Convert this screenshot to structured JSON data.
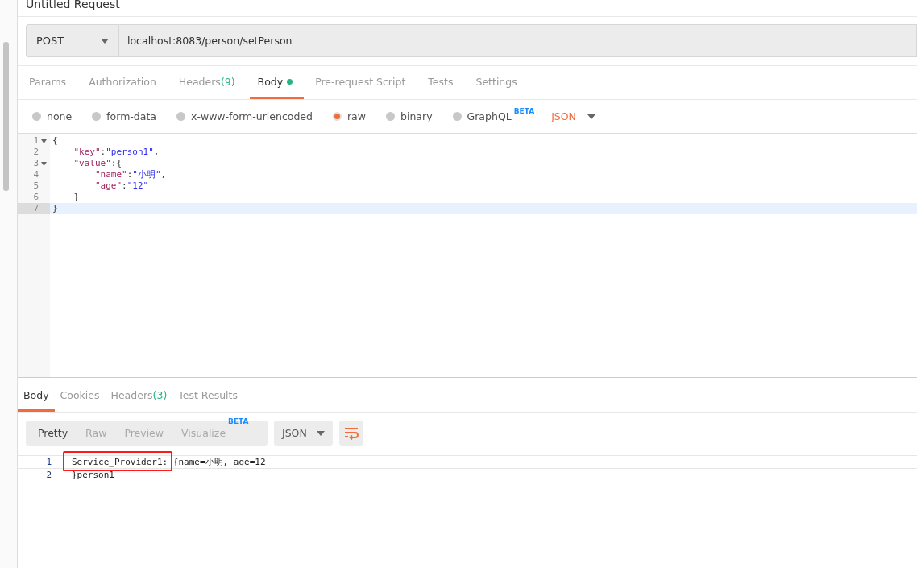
{
  "title": "Untitled Request",
  "request": {
    "method": "POST",
    "url": "localhost:8083/person/setPerson"
  },
  "tabs": [
    {
      "label": "Params",
      "selected": false
    },
    {
      "label": "Authorization",
      "selected": false
    },
    {
      "label": "Headers",
      "count": "(9)",
      "selected": false
    },
    {
      "label": "Body",
      "dot": true,
      "selected": true
    },
    {
      "label": "Pre-request Script",
      "selected": false
    },
    {
      "label": "Tests",
      "selected": false
    },
    {
      "label": "Settings",
      "selected": false
    }
  ],
  "body_types": [
    {
      "label": "none",
      "selected": false
    },
    {
      "label": "form-data",
      "selected": false
    },
    {
      "label": "x-www-form-urlencoded",
      "selected": false
    },
    {
      "label": "raw",
      "selected": true
    },
    {
      "label": "binary",
      "selected": false
    },
    {
      "label": "GraphQL",
      "badge": "BETA",
      "selected": false
    }
  ],
  "format": "JSON",
  "editor_lines": [
    {
      "number": "1",
      "foldable": true,
      "active": false,
      "tokens": [
        {
          "kind": "punct",
          "text": "{"
        }
      ]
    },
    {
      "number": "2",
      "foldable": false,
      "active": false,
      "tokens": [
        {
          "kind": "key",
          "text": "    \"key\""
        },
        {
          "kind": "punct",
          "text": ":"
        },
        {
          "kind": "str",
          "text": "\"person1\""
        },
        {
          "kind": "punct",
          "text": ","
        }
      ]
    },
    {
      "number": "3",
      "foldable": true,
      "active": false,
      "tokens": [
        {
          "kind": "key",
          "text": "    \"value\""
        },
        {
          "kind": "punct",
          "text": ":{"
        }
      ]
    },
    {
      "number": "4",
      "foldable": false,
      "active": false,
      "tokens": [
        {
          "kind": "key",
          "text": "        \"name\""
        },
        {
          "kind": "punct",
          "text": ":"
        },
        {
          "kind": "str",
          "text": "\"小明\""
        },
        {
          "kind": "punct",
          "text": ","
        }
      ]
    },
    {
      "number": "5",
      "foldable": false,
      "active": false,
      "tokens": [
        {
          "kind": "key",
          "text": "        \"age\""
        },
        {
          "kind": "punct",
          "text": ":"
        },
        {
          "kind": "str",
          "text": "\"12\""
        }
      ]
    },
    {
      "number": "6",
      "foldable": false,
      "active": false,
      "tokens": [
        {
          "kind": "punct",
          "text": "    }"
        }
      ]
    },
    {
      "number": "7",
      "foldable": false,
      "active": true,
      "tokens": [
        {
          "kind": "punct",
          "text": "}"
        }
      ]
    }
  ],
  "response_tabs": [
    {
      "label": "Body",
      "selected": true
    },
    {
      "label": "Cookies",
      "selected": false
    },
    {
      "label": "Headers",
      "count": "(3)",
      "selected": false
    },
    {
      "label": "Test Results",
      "selected": false
    }
  ],
  "view_modes": [
    {
      "label": "Pretty",
      "selected": true
    },
    {
      "label": "Raw",
      "selected": false
    },
    {
      "label": "Preview",
      "selected": false
    },
    {
      "label": "Visualize",
      "badge": "BETA",
      "selected": false
    }
  ],
  "response_format": "JSON",
  "response_lines": [
    {
      "number": "1",
      "marked": "Service_Provider1:",
      "text": " {name=小明, age=12"
    },
    {
      "number": "2",
      "text": "}person1"
    }
  ]
}
